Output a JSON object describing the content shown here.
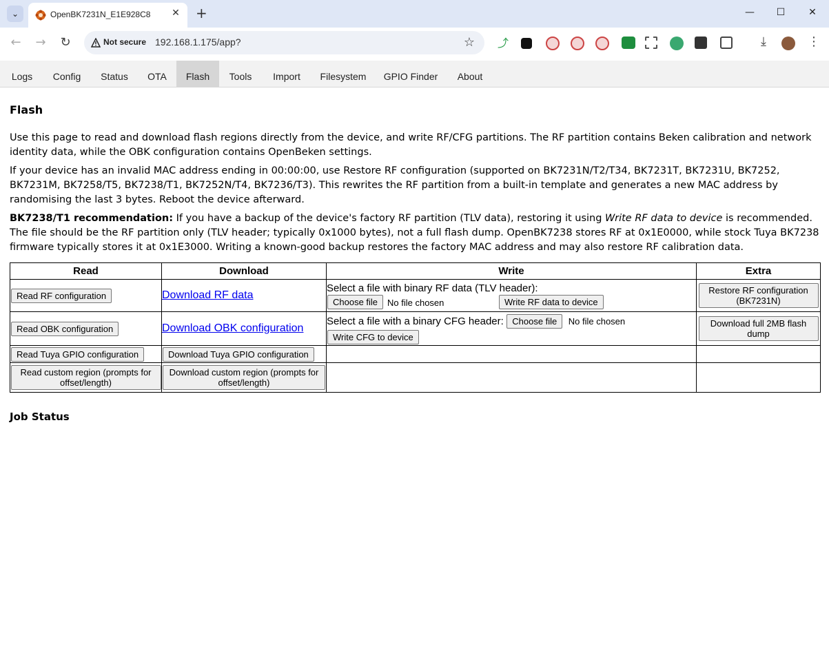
{
  "browser": {
    "tab_title": "OpenBK7231N_E1E928C8",
    "security_label": "Not secure",
    "url": "192.168.1.175/app?"
  },
  "nav": {
    "tabs": [
      "Logs",
      "Config",
      "Status",
      "OTA",
      "Flash",
      "Tools",
      "Import",
      "Filesystem",
      "GPIO Finder",
      "About"
    ],
    "active": "Flash"
  },
  "page": {
    "title": "Flash",
    "p1": "Use this page to read and download flash regions directly from the device, and write RF/CFG partitions. The RF partition contains Beken calibration and network identity data, while the OBK configuration contains OpenBeken settings.",
    "p2": "If your device has an invalid MAC address ending in 00:00:00, use Restore RF configuration (supported on BK7231N/T2/T34, BK7231T, BK7231U, BK7252, BK7231M, BK7258/T5, BK7238/T1, BK7252N/T4, BK7236/T3). This rewrites the RF partition from a built-in template and generates a new MAC address by randomising the last 3 bytes. Reboot the device afterward.",
    "p3_bold": "BK7238/T1 recommendation:",
    "p3_a": " If you have a backup of the device's factory RF partition (TLV data), restoring it using ",
    "p3_ital": "Write RF data to device",
    "p3_b": " is recommended. The file should be the RF partition only (TLV header; typically 0x1000 bytes), not a full flash dump. OpenBK7238 stores RF at 0x1E0000, while stock Tuya BK7238 firmware typically stores it at 0x1E3000. Writing a known-good backup restores the factory MAC address and may also restore RF calibration data.",
    "job_status": "Job Status"
  },
  "table": {
    "headers": {
      "read": "Read",
      "download": "Download",
      "write": "Write",
      "extra": "Extra"
    },
    "read_rf": "Read RF configuration",
    "download_rf": "Download RF data",
    "write_rf_label": "Select a file with binary RF data (TLV header):",
    "choose_file": "Choose file",
    "no_file": "No file chosen",
    "write_rf_btn": "Write RF data to device",
    "restore_rf": "Restore RF configuration (BK7231N)",
    "read_obk": "Read OBK configuration",
    "download_obk": "Download OBK configuration",
    "write_cfg_label": "Select a file with a binary CFG header:",
    "write_cfg_btn": "Write CFG to device",
    "download_full": "Download full 2MB flash dump",
    "read_tuya": "Read Tuya GPIO configuration",
    "download_tuya": "Download Tuya GPIO configuration",
    "read_custom": "Read custom region (prompts for offset/length)",
    "download_custom": "Download custom region (prompts for offset/length)"
  }
}
